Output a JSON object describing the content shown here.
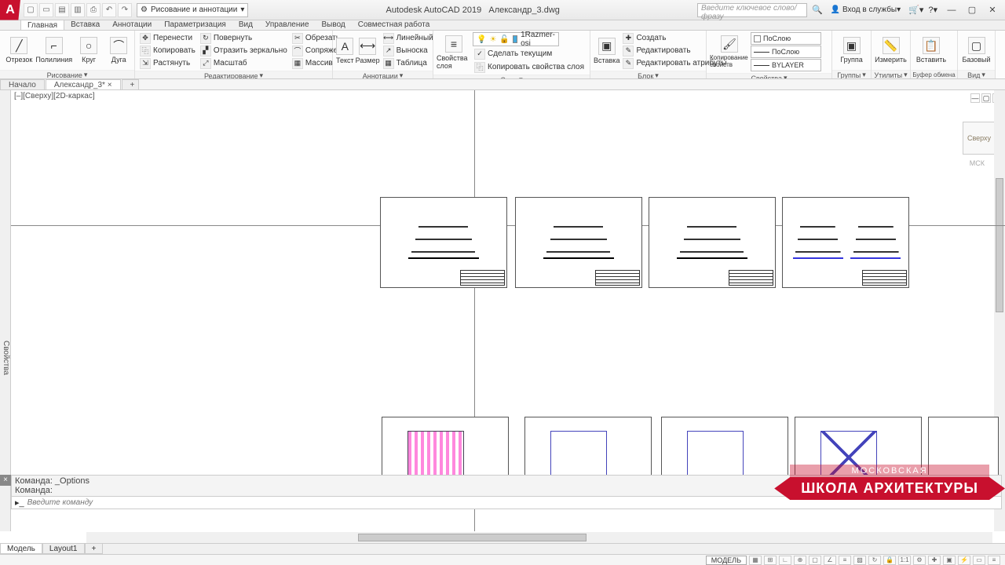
{
  "app": {
    "title": "Autodesk AutoCAD 2019",
    "file": "Александр_3.dwg",
    "logo": "A"
  },
  "workspace": "Рисование и аннотации",
  "search_placeholder": "Введите ключевое слово/фразу",
  "signin": "Вход в службы",
  "menu_tabs": [
    "Главная",
    "Вставка",
    "Аннотации",
    "Параметризация",
    "Вид",
    "Управление",
    "Вывод",
    "Совместная работа"
  ],
  "ribbon": {
    "draw": {
      "title": "Рисование",
      "b1": "Отрезок",
      "b2": "Полилиния",
      "b3": "Круг",
      "b4": "Дуга"
    },
    "modify": {
      "title": "Редактирование",
      "r1": [
        "Перенести",
        "Повернуть",
        "Обрезать"
      ],
      "r2": [
        "Копировать",
        "Отразить зеркально",
        "Сопряжение"
      ],
      "r3": [
        "Растянуть",
        "Масштаб",
        "Массив"
      ]
    },
    "annot": {
      "title": "Аннотации",
      "b1": "Текст",
      "b2": "Размер",
      "items": [
        "Линейный",
        "Выноска",
        "Таблица"
      ]
    },
    "layers": {
      "title": "Слои",
      "b1": "Свойства слоя",
      "combo": "1Razmer-osi",
      "items": [
        "Сделать текущим",
        "Копировать свойства слоя"
      ]
    },
    "block": {
      "title": "Блок",
      "b1": "Вставка",
      "items": [
        "Создать",
        "Редактировать",
        "Редактировать атрибуты"
      ]
    },
    "props": {
      "title": "Свойства",
      "b1": "Копирование свойств",
      "c1": "ПоСлою",
      "c2": "ПоСлою",
      "c3": "BYLAYER"
    },
    "groups": {
      "title": "Группы",
      "b1": "Группа"
    },
    "utils": {
      "title": "Утилиты",
      "b1": "Измерить"
    },
    "clip": {
      "title": "Буфер обмена",
      "b1": "Вставить"
    },
    "view": {
      "title": "Вид",
      "b1": "Базовый"
    }
  },
  "file_tabs": {
    "t1": "Начало",
    "t2": "Александр_3*"
  },
  "viewport": {
    "label": "[–][Сверху][2D-каркас]",
    "cube": "Сверху",
    "wcs": "МСК",
    "side": "Свойства"
  },
  "cmd": {
    "l1": "Команда: _Options",
    "l2": "Команда:",
    "ph": "Введите команду"
  },
  "layout": {
    "t1": "Модель",
    "t2": "Layout1"
  },
  "status": {
    "space": "МОДЕЛЬ"
  },
  "watermark": {
    "top": "МОСКОВСКАЯ",
    "main": "ШКОЛА АРХИТЕКТУРЫ"
  }
}
